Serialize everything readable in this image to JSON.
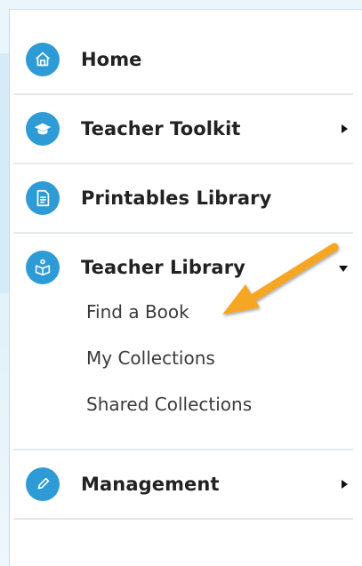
{
  "menu": {
    "items": [
      {
        "label": "Home",
        "icon": "home-icon"
      },
      {
        "label": "Teacher Toolkit",
        "icon": "graduation-cap-icon",
        "caret": "right"
      },
      {
        "label": "Printables Library",
        "icon": "document-icon"
      },
      {
        "label": "Teacher Library",
        "icon": "open-book-icon",
        "caret": "down",
        "expanded": true
      },
      {
        "label": "Management",
        "icon": "pencil-icon",
        "caret": "right"
      }
    ],
    "teacher_library_submenu": [
      {
        "label": "Find a Book"
      },
      {
        "label": "My Collections"
      },
      {
        "label": "Shared Collections"
      }
    ]
  },
  "colors": {
    "icon_background": "#2e9bd6",
    "annotation_arrow": "#f5a623",
    "divider": "#e6e9ec"
  }
}
